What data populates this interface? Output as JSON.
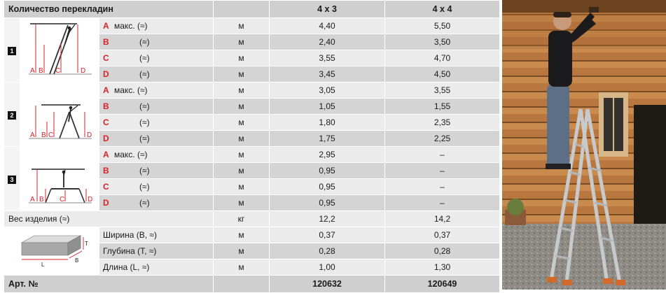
{
  "header": {
    "title": "Количество перекладин",
    "col_4x3": "4 x 3",
    "col_4x4": "4 x 4"
  },
  "groups": [
    {
      "index": "1",
      "rows": [
        {
          "letter": "A",
          "suffix": "макс. (≈)",
          "unit": "м",
          "v43": "4,40",
          "v44": "5,50"
        },
        {
          "letter": "B",
          "suffix": "(≈)",
          "unit": "м",
          "v43": "2,40",
          "v44": "3,50"
        },
        {
          "letter": "C",
          "suffix": "(≈)",
          "unit": "м",
          "v43": "3,55",
          "v44": "4,70"
        },
        {
          "letter": "D",
          "suffix": "(≈)",
          "unit": "м",
          "v43": "3,45",
          "v44": "4,50"
        }
      ]
    },
    {
      "index": "2",
      "rows": [
        {
          "letter": "A",
          "suffix": "макс. (≈)",
          "unit": "м",
          "v43": "3,05",
          "v44": "3,55"
        },
        {
          "letter": "B",
          "suffix": "(≈)",
          "unit": "м",
          "v43": "1,05",
          "v44": "1,55"
        },
        {
          "letter": "C",
          "suffix": "(≈)",
          "unit": "м",
          "v43": "1,80",
          "v44": "2,35"
        },
        {
          "letter": "D",
          "suffix": "(≈)",
          "unit": "м",
          "v43": "1,75",
          "v44": "2,25"
        }
      ]
    },
    {
      "index": "3",
      "rows": [
        {
          "letter": "A",
          "suffix": "макс. (≈)",
          "unit": "м",
          "v43": "2,95",
          "v44": "–"
        },
        {
          "letter": "B",
          "suffix": "(≈)",
          "unit": "м",
          "v43": "0,95",
          "v44": "–"
        },
        {
          "letter": "C",
          "suffix": "(≈)",
          "unit": "м",
          "v43": "0,95",
          "v44": "–"
        },
        {
          "letter": "D",
          "suffix": "(≈)",
          "unit": "м",
          "v43": "0,95",
          "v44": "–"
        }
      ]
    }
  ],
  "weight": {
    "label": "Вес изделия (≈)",
    "unit": "кг",
    "v43": "12,2",
    "v44": "14,2"
  },
  "dims": {
    "icon_labels": {
      "t": "T",
      "l": "L",
      "b": "B"
    },
    "rows": [
      {
        "label": "Ширина (B, ≈)",
        "unit": "м",
        "v43": "0,37",
        "v44": "0,37"
      },
      {
        "label": "Глубина (T, ≈)",
        "unit": "м",
        "v43": "0,28",
        "v44": "0,28"
      },
      {
        "label": "Длина (L, ≈)",
        "unit": "м",
        "v43": "1,00",
        "v44": "1,30"
      }
    ]
  },
  "footer": {
    "label": "Арт. №",
    "v43": "120632",
    "v44": "120649"
  },
  "diagram_letters": [
    "A",
    "B",
    "C",
    "D"
  ],
  "colors": {
    "accent": "#d6232b",
    "header_bg": "#cfcfcf",
    "band_light": "#ebebeb",
    "band_dark": "#d4d4d4"
  }
}
